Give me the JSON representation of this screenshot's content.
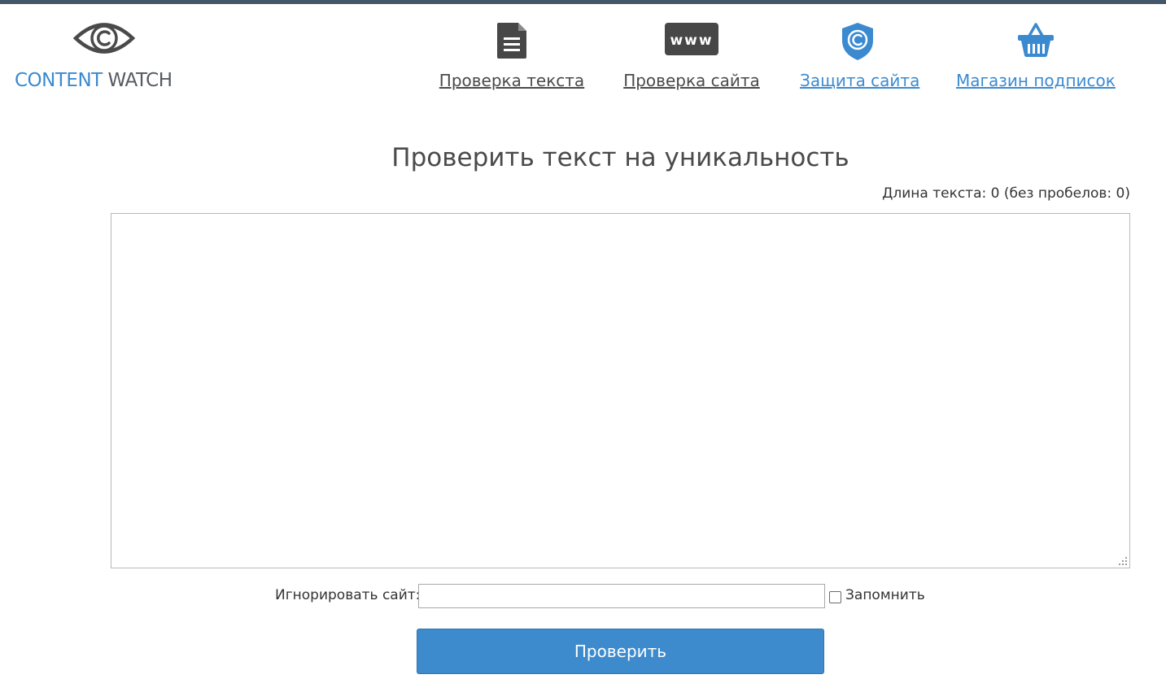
{
  "logo": {
    "word1": "CONTENT",
    "word2": "WATCH",
    "icon": "eye-copyright-icon",
    "color_primary": "#3b8ad0",
    "color_secondary": "#555b62"
  },
  "nav": [
    {
      "label": "Проверка текста",
      "icon": "document-icon",
      "style": "dark"
    },
    {
      "label": "Проверка сайта",
      "icon": "www-icon",
      "style": "dark"
    },
    {
      "label": "Защита сайта",
      "icon": "shield-copyright-icon",
      "style": "blue"
    },
    {
      "label": "Магазин подписок",
      "icon": "basket-icon",
      "style": "blue"
    }
  ],
  "main": {
    "title": "Проверить текст на уникальность",
    "text_length_label": "Длина текста: 0 (без пробелов: 0)",
    "textarea_value": "",
    "ignore_label": "Игнорировать сайт:",
    "ignore_value": "",
    "remember_label": "Запомнить",
    "remember_checked": false,
    "submit_label": "Проверить"
  },
  "colors": {
    "accent": "#3d8bcd",
    "link_blue": "#3b8ad0",
    "header_strip": "#44576a",
    "dark_icon": "#474747"
  }
}
